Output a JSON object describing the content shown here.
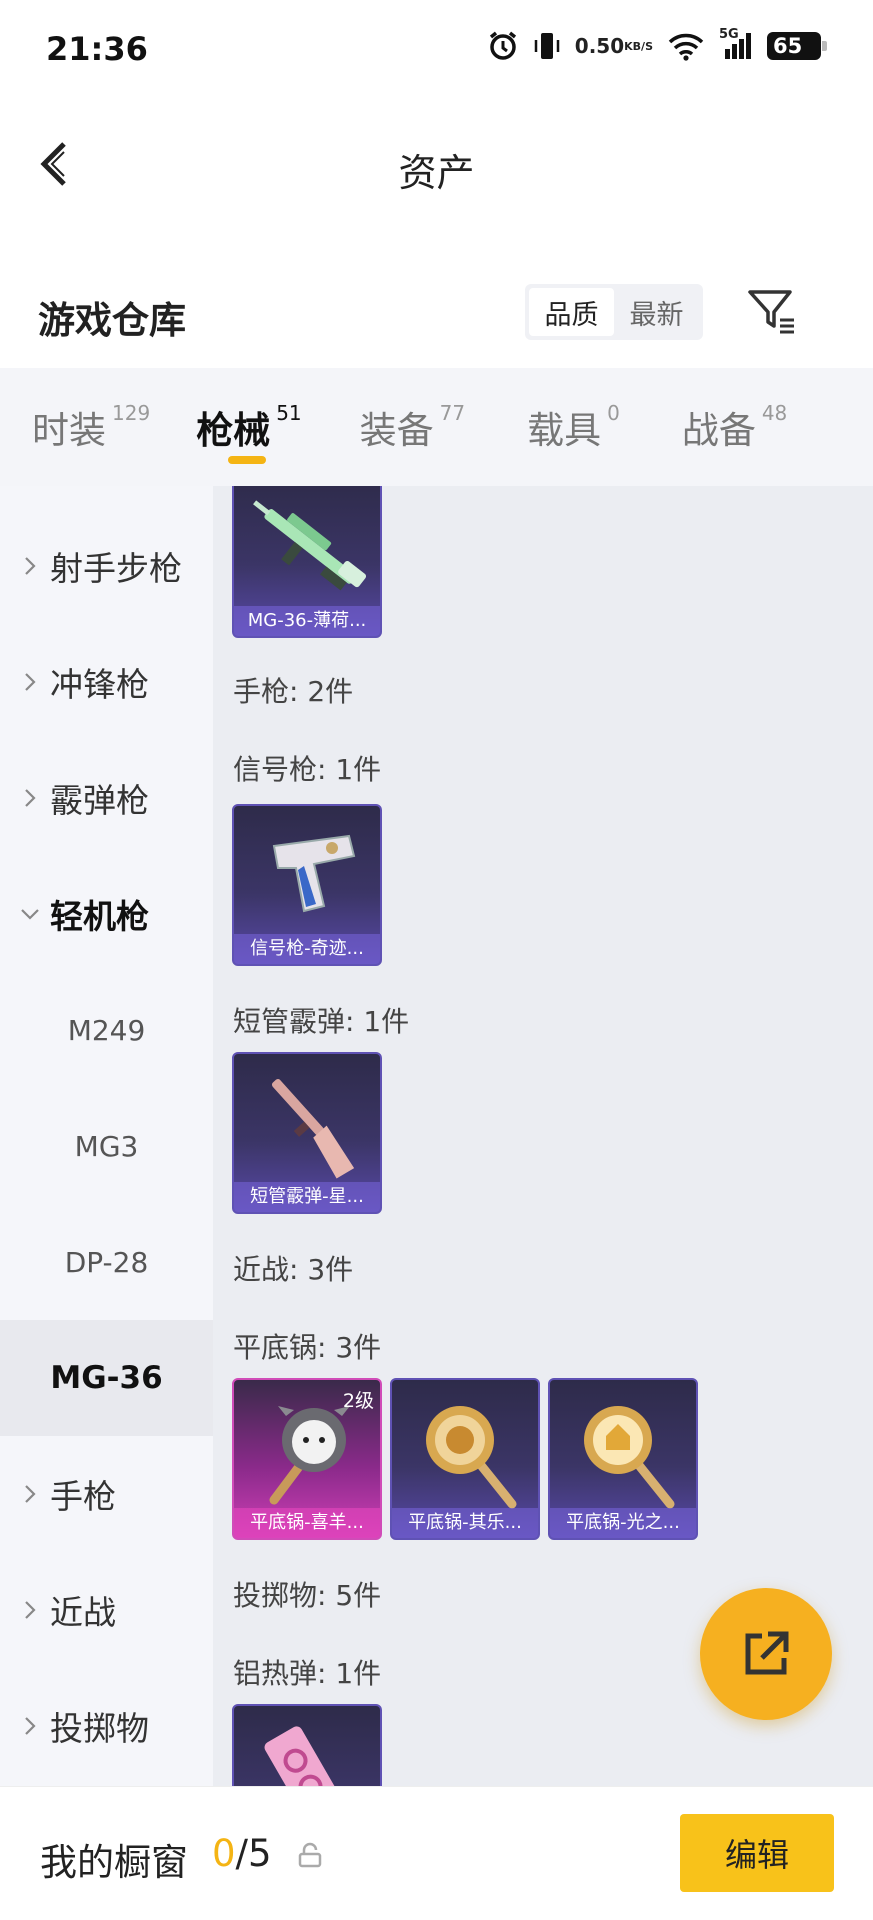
{
  "status": {
    "time": "21:36",
    "net_speed": "0.50",
    "net_unit": "KB/S",
    "signal_label": "5G",
    "battery": "65"
  },
  "nav": {
    "title": "资产"
  },
  "header": {
    "title": "游戏仓库",
    "sort_options": [
      "品质",
      "最新"
    ],
    "sort_active": "品质"
  },
  "tabs": [
    {
      "label": "时装",
      "count": "129"
    },
    {
      "label": "枪械",
      "count": "51"
    },
    {
      "label": "装备",
      "count": "77"
    },
    {
      "label": "载具",
      "count": "0"
    },
    {
      "label": "战备",
      "count": "48"
    }
  ],
  "sidebar": {
    "items": [
      {
        "label": "射手步枪"
      },
      {
        "label": "冲锋枪"
      },
      {
        "label": "霰弹枪"
      },
      {
        "label": "轻机枪"
      },
      {
        "label": "手枪"
      },
      {
        "label": "近战"
      },
      {
        "label": "投掷物"
      }
    ],
    "subitems": [
      {
        "label": "M249"
      },
      {
        "label": "MG3"
      },
      {
        "label": "DP-28"
      },
      {
        "label": "MG-36"
      }
    ]
  },
  "main": {
    "groups": [
      {
        "label": "手枪: 2件"
      },
      {
        "label": "信号枪: 1件"
      },
      {
        "label": "短管霰弹: 1件"
      },
      {
        "label": "近战: 3件"
      },
      {
        "label": "平底锅: 3件"
      },
      {
        "label": "投掷物: 5件"
      },
      {
        "label": "铝热弹: 1件"
      }
    ],
    "cards": [
      {
        "name": "MG-36-薄荷..."
      },
      {
        "name": "信号枪-奇迹..."
      },
      {
        "name": "短管霰弹-星..."
      },
      {
        "name": "平底锅-喜羊...",
        "level": "2级"
      },
      {
        "name": "平底锅-其乐..."
      },
      {
        "name": "平底锅-光之..."
      }
    ]
  },
  "bottom": {
    "showcase_label": "我的橱窗",
    "showcase_current": "0",
    "showcase_total": "/5",
    "edit_label": "编辑"
  }
}
